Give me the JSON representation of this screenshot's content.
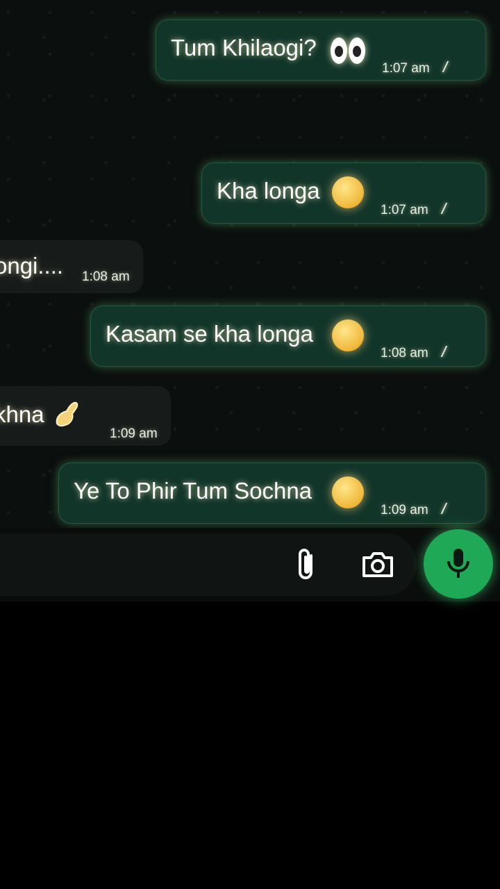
{
  "messages": [
    {
      "direction": "out",
      "text": "Tum Khilaogi?",
      "emoji": "eyes-emoji",
      "time": "1:07 am",
      "status": "read"
    },
    {
      "direction": "out",
      "text": "Kha longa",
      "emoji": "melting-face-emoji",
      "time": "1:07 am",
      "status": "read"
    },
    {
      "direction": "in",
      "text": "ongi....",
      "time": "1:08 am"
    },
    {
      "direction": "out",
      "text": "Kasam se kha longa",
      "emoji": "relieved-face-emoji",
      "time": "1:08 am",
      "status": "read"
    },
    {
      "direction": "in",
      "text": "khna",
      "emoji": "pinched-fingers-emoji",
      "time": "1:09 am"
    },
    {
      "direction": "out",
      "text": "Ye To Phir Tum Sochna",
      "emoji": "smiling-face-emoji",
      "time": "1:09 am",
      "status": "read"
    }
  ],
  "input_bar": {
    "attach_icon": "paperclip-icon",
    "camera_icon": "camera-icon",
    "mic_icon": "microphone-icon"
  },
  "colors": {
    "outgoing_bubble": "#12352a",
    "incoming_bubble": "#171b1a",
    "mic_button": "#1fa855",
    "background": "#0b0f0e"
  }
}
